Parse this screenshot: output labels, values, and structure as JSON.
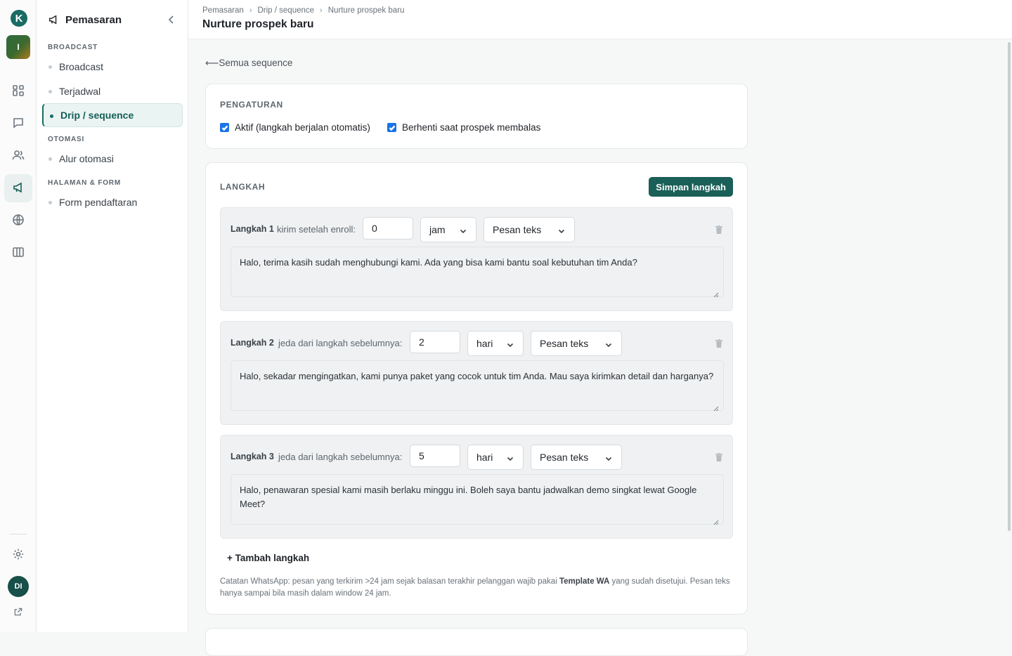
{
  "rail": {
    "logo_letter": "K",
    "workspace_initial": "I",
    "avatar_initials": "DI",
    "icons": [
      "dashboard-icon",
      "chat-icon",
      "contacts-icon",
      "megaphone-icon",
      "globe-icon",
      "columns-icon",
      "gear-icon",
      "external-link-icon"
    ]
  },
  "sidebar": {
    "title": "Pemasaran",
    "sections": [
      {
        "label": "BROADCAST",
        "items": [
          {
            "label": "Broadcast",
            "active": false
          },
          {
            "label": "Terjadwal",
            "active": false
          },
          {
            "label": "Drip / sequence",
            "active": true
          }
        ]
      },
      {
        "label": "OTOMASI",
        "items": [
          {
            "label": "Alur otomasi",
            "active": false
          }
        ]
      },
      {
        "label": "HALAMAN & FORM",
        "items": [
          {
            "label": "Form pendaftaran",
            "active": false
          }
        ]
      }
    ]
  },
  "header": {
    "breadcrumbs": [
      "Pemasaran",
      "Drip / sequence",
      "Nurture prospek baru"
    ],
    "title": "Nurture prospek baru"
  },
  "main": {
    "back_link": "Semua sequence",
    "settings": {
      "label": "PENGATURAN",
      "active_label": "Aktif (langkah berjalan otomatis)",
      "active_checked": true,
      "stop_label": "Berhenti saat prospek membalas",
      "stop_checked": true
    },
    "steps_card": {
      "label": "LANGKAH",
      "save_button": "Simpan langkah",
      "steps": [
        {
          "label": "Langkah 1",
          "delay_desc": "kirim setelah enroll:",
          "delay_value": "0",
          "unit": "jam",
          "type": "Pesan teks",
          "message": "Halo, terima kasih sudah menghubungi kami. Ada yang bisa kami bantu soal kebutuhan tim Anda?"
        },
        {
          "label": "Langkah 2",
          "delay_desc": "jeda dari langkah sebelumnya:",
          "delay_value": "2",
          "unit": "hari",
          "type": "Pesan teks",
          "message": "Halo, sekadar mengingatkan, kami punya paket yang cocok untuk tim Anda. Mau saya kirimkan detail dan harganya?"
        },
        {
          "label": "Langkah 3",
          "delay_desc": "jeda dari langkah sebelumnya:",
          "delay_value": "5",
          "unit": "hari",
          "type": "Pesan teks",
          "message": "Halo, penawaran spesial kami masih berlaku minggu ini. Boleh saya bantu jadwalkan demo singkat lewat Google Meet?"
        }
      ],
      "add_step": "+ Tambah langkah",
      "note_before": "Catatan WhatsApp: pesan yang terkirim >24 jam sejak balasan terakhir pelanggan wajib pakai ",
      "note_bold": "Template WA",
      "note_after": " yang sudah disetujui. Pesan teks hanya sampai bila masih dalam window 24 jam."
    }
  },
  "colors": {
    "brand": "#1a5f58",
    "checkbox": "#1a73e8"
  }
}
